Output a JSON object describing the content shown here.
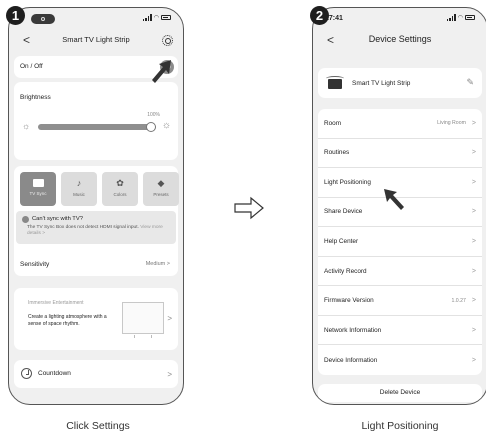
{
  "steps": [
    {
      "number": "1",
      "caption": "Click Settings",
      "screen": {
        "title": "Smart TV Light Strip",
        "onoff_label": "On / Off",
        "brightness": {
          "label": "Brightness",
          "percent_label": "100%",
          "value_fraction": 1.0
        },
        "modes": [
          {
            "label": "TV Sync",
            "icon": "tv-icon",
            "active": true
          },
          {
            "label": "Music",
            "icon": "music-icon",
            "active": false
          },
          {
            "label": "Colors",
            "icon": "palette-icon",
            "active": false
          },
          {
            "label": "Presets",
            "icon": "presets-icon",
            "active": false
          }
        ],
        "sync_notice": {
          "question": "Can't sync with TV?",
          "description": "The TV Sync Box does not detect HDMI signal input.",
          "link": "View more details >"
        },
        "sensitivity": {
          "label": "Sensitivity",
          "value": "Medium"
        },
        "immersive": {
          "title": "Immersive Entertainment",
          "description": "Create a lighting atmosphere with a sense of space rhythm."
        },
        "countdown_label": "Countdown"
      }
    },
    {
      "number": "2",
      "caption": "Light Positioning",
      "screen": {
        "status_time": "17:41",
        "title": "Device Settings",
        "device_name": "Smart TV Light Strip",
        "rows": [
          {
            "label": "Room",
            "value": "Living Room"
          },
          {
            "label": "Routines",
            "value": ""
          },
          {
            "label": "Light Positioning",
            "value": ""
          },
          {
            "label": "Share Device",
            "value": ""
          },
          {
            "label": "Help Center",
            "value": ""
          },
          {
            "label": "Activity Record",
            "value": ""
          },
          {
            "label": "Firmware Version",
            "value": "1.0.27"
          },
          {
            "label": "Network Information",
            "value": ""
          },
          {
            "label": "Device Information",
            "value": ""
          }
        ],
        "delete_label": "Delete Device"
      }
    }
  ],
  "glyphs": {
    "back": "<",
    "chevron": ">",
    "pencil": "✎",
    "power": "⏻",
    "sun": "☼"
  },
  "colors": {
    "active_tab": "#8a8a8a",
    "pointer": "#333333"
  }
}
